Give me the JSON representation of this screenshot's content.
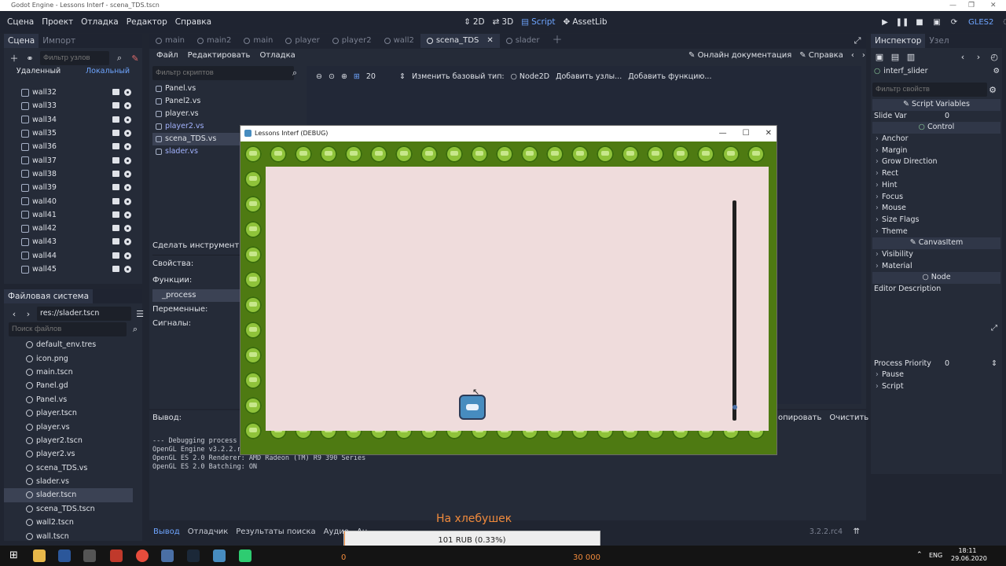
{
  "window_title": "Godot Engine - Lessons Interf - scena_TDS.tscn",
  "menu": [
    "Сцена",
    "Проект",
    "Отладка",
    "Редактор",
    "Справка"
  ],
  "workspaces": [
    {
      "label": "2D",
      "icon": "2d-icon"
    },
    {
      "label": "3D",
      "icon": "3d-icon"
    },
    {
      "label": "Script",
      "icon": "script-icon"
    },
    {
      "label": "AssetLib",
      "icon": "assetlib-icon"
    }
  ],
  "renderer": "GLES2",
  "scene_dock": {
    "tabs": [
      "Сцена",
      "Импорт"
    ],
    "filter_placeholder": "Фильтр узлов",
    "remote_label": "Удаленный",
    "local_label": "Локальный",
    "nodes": [
      "wall32",
      "wall33",
      "wall34",
      "wall35",
      "wall36",
      "wall37",
      "wall38",
      "wall39",
      "wall40",
      "wall41",
      "wall42",
      "wall43",
      "wall44",
      "wall45"
    ]
  },
  "filesystem_dock": {
    "title": "Файловая система",
    "path": "res://slader.tscn",
    "search_placeholder": "Поиск файлов",
    "files": [
      "default_env.tres",
      "icon.png",
      "main.tscn",
      "Panel.gd",
      "Panel.vs",
      "player.tscn",
      "player.vs",
      "player2.tscn",
      "player2.vs",
      "scena_TDS.vs",
      "slader.vs",
      "slader.tscn",
      "scena_TDS.tscn",
      "wall2.tscn",
      "wall.tscn"
    ],
    "selected": "slader.tscn"
  },
  "editor_tabs": [
    {
      "label": "main",
      "active": false
    },
    {
      "label": "main2",
      "active": false
    },
    {
      "label": "main",
      "active": false
    },
    {
      "label": "player",
      "active": false
    },
    {
      "label": "player2",
      "active": false
    },
    {
      "label": "wall2",
      "active": false
    },
    {
      "label": "scena_TDS",
      "active": true
    },
    {
      "label": "slader",
      "active": false
    }
  ],
  "script_menu": [
    "Файл",
    "Редактировать",
    "Отладка"
  ],
  "online_docs": "Онлайн документация",
  "help_label": "Справка",
  "script_filter_placeholder": "Фильтр скриптов",
  "scripts": [
    "Panel.vs",
    "Panel2.vs",
    "player.vs",
    "player2.vs",
    "scena_TDS.vs",
    "slader.vs"
  ],
  "selected_script": "scena_TDS.vs",
  "vs_toolbar": {
    "zoom": "20",
    "change_base_type": "Изменить базовый тип:",
    "base_type": "Node2D",
    "add_nodes": "Добавить узлы...",
    "add_function": "Добавить функцию..."
  },
  "members": {
    "make_tool": "Сделать инструмент:",
    "properties": "Свойства:",
    "functions": "Функции:",
    "function_item": "_process",
    "variables": "Переменные:",
    "signals": "Сигналы:"
  },
  "output": {
    "label": "Вывод:",
    "copy": "опировать",
    "clear": "Очистить",
    "lines": [
      "--- Debugging process",
      "OpenGL Engine v3.2.2.r",
      "OpenGL ES 2.0 Renderer: AMD Radeon (TM) R9 390 Series",
      "OpenGL ES 2.0 Batching: ON"
    ]
  },
  "bottom_tabs": [
    "Вывод",
    "Отладчик",
    "Результаты поиска",
    "Аудио",
    "Ан"
  ],
  "version": "3.2.2.rc4",
  "game_window": {
    "title": "Lessons Interf (DEBUG)",
    "slider_value": 0.93
  },
  "inspector": {
    "tabs": [
      "Инспектор",
      "Узел"
    ],
    "node_name": "interf_slider",
    "filter_placeholder": "Фильтр свойств",
    "script_variables": "Script Variables",
    "slide_var_label": "Slide Var",
    "slide_var_value": "0",
    "control_label": "Control",
    "control_props": [
      "Anchor",
      "Margin",
      "Grow Direction",
      "Rect",
      "Hint",
      "Focus",
      "Mouse",
      "Size Flags",
      "Theme"
    ],
    "canvas_item_label": "CanvasItem",
    "canvas_props": [
      "Visibility",
      "Material"
    ],
    "node_label": "Node",
    "editor_description": "Editor Description",
    "process_priority_label": "Process Priority",
    "process_priority_value": "0",
    "node_props": [
      "Pause",
      "Script"
    ]
  },
  "stream_overlay": {
    "title": "На хлебушек",
    "bar_text": "101 RUB (0.33%)",
    "progress": 0.0033,
    "min": "0",
    "max": "30 000"
  },
  "taskbar": {
    "lang": "ENG",
    "time": "18:11",
    "date": "29.06.2020"
  }
}
